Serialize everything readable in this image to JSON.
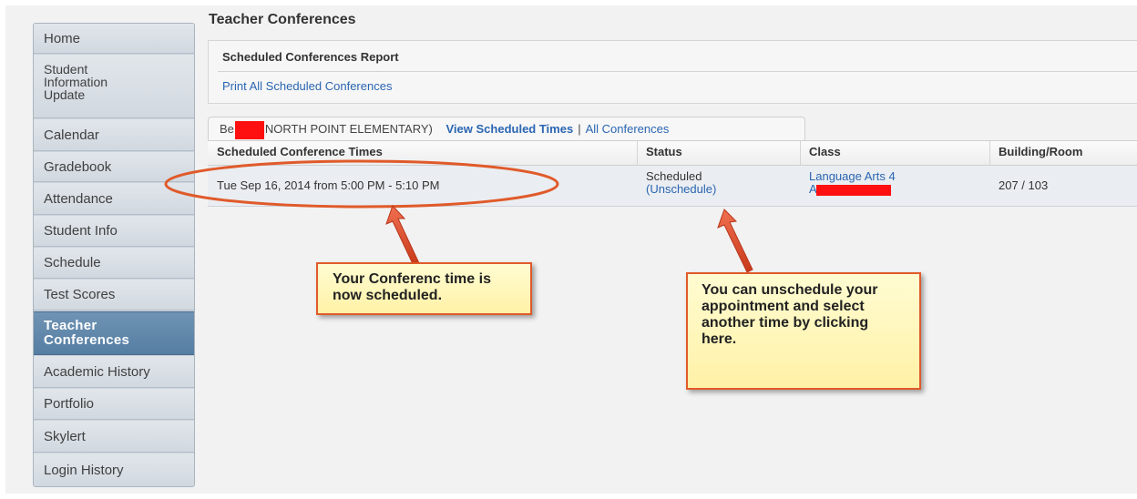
{
  "page": {
    "title": "Teacher Conferences"
  },
  "sidebar": {
    "items": [
      {
        "label": "Home"
      },
      {
        "label": "Student Information Update"
      },
      {
        "label": "Calendar"
      },
      {
        "label": "Gradebook"
      },
      {
        "label": "Attendance"
      },
      {
        "label": "Student Info"
      },
      {
        "label": "Schedule"
      },
      {
        "label": "Test Scores"
      },
      {
        "label": "Teacher Conferences",
        "active": true
      },
      {
        "label": "Academic History"
      },
      {
        "label": "Portfolio"
      },
      {
        "label": "Skylert"
      },
      {
        "label": "Login History"
      }
    ]
  },
  "report": {
    "heading": "Scheduled Conferences Report",
    "print_link": "Print All Scheduled Conferences"
  },
  "tab": {
    "student_prefix": "Be",
    "school": "NORTH POINT ELEMENTARY)",
    "view_scheduled": "View Scheduled Times",
    "separator": "|",
    "all_conferences": "All Conferences"
  },
  "table": {
    "headers": [
      "Scheduled Conference Times",
      "Status",
      "Class",
      "Building/Room"
    ],
    "rows": [
      {
        "time": "Tue Sep 16, 2014 from 5:00 PM - 5:10 PM",
        "status": "Scheduled",
        "unschedule": "(Unschedule)",
        "class": "Language Arts 4",
        "class_sub": "A",
        "room": "207 / 103"
      }
    ]
  },
  "callouts": {
    "scheduled": "Your Conferenc time is now scheduled.",
    "unschedule": "You can unschedule your appointment and select another time by clicking here."
  },
  "colors": {
    "link": "#2a66b2",
    "active_nav": "#5f86a8",
    "annotation": "#e05a2a",
    "redaction": "#ff1010",
    "callout_fill": "#fff6bb"
  }
}
